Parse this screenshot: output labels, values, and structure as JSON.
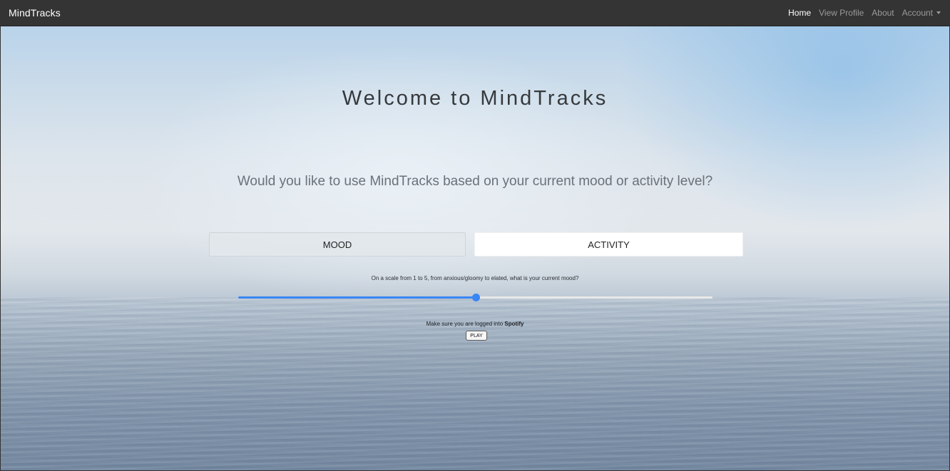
{
  "navbar": {
    "brand": "MindTracks",
    "links": [
      {
        "label": "Home",
        "active": true
      },
      {
        "label": "View Profile",
        "active": false
      },
      {
        "label": "About",
        "active": false
      },
      {
        "label": "Account",
        "active": false,
        "dropdown": true
      }
    ]
  },
  "main": {
    "title": "Welcome to MindTracks",
    "question": "Would you like to use MindTracks based on your current mood or activity level?",
    "tabs": [
      {
        "label": "MOOD",
        "selected": true
      },
      {
        "label": "ACTIVITY",
        "selected": false
      }
    ],
    "scale_prompt": "On a scale from 1 to 5, from anxious/gloomy to elated, what is your current mood?",
    "slider": {
      "min": 1,
      "max": 5,
      "value": 3,
      "fill_color": "#3a86f4"
    },
    "spotify_note_prefix": "Make sure you are logged into ",
    "spotify_note_bold": "Spotify",
    "play_label": "PLAY"
  },
  "colors": {
    "accent": "#3a86f4",
    "navbar_bg": "#343434"
  }
}
